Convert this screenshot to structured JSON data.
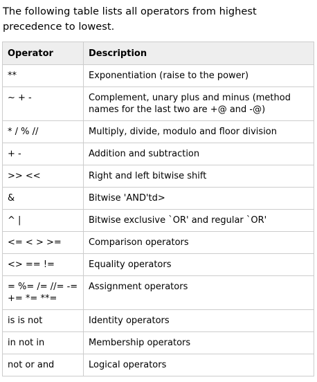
{
  "intro": "The following table lists all operators from highest precedence to lowest.",
  "table": {
    "headers": [
      "Operator",
      "Description"
    ],
    "rows": [
      {
        "operator": "**",
        "description": "Exponentiation (raise to the power)"
      },
      {
        "operator": "~ + -",
        "description": "Complement, unary plus and minus (method names for the last two are +@ and -@)"
      },
      {
        "operator": "* / % //",
        "description": "Multiply, divide, modulo and floor division"
      },
      {
        "operator": "+ -",
        "description": "Addition and subtraction"
      },
      {
        "operator": ">> <<",
        "description": "Right and left bitwise shift"
      },
      {
        "operator": "&",
        "description": "Bitwise 'AND'td>"
      },
      {
        "operator": "^ |",
        "description": "Bitwise exclusive `OR' and regular `OR'"
      },
      {
        "operator": "<= < > >=",
        "description": "Comparison operators"
      },
      {
        "operator": "<> == !=",
        "description": "Equality operators"
      },
      {
        "operator": "= %= /= //= -= += *= **=",
        "description": "Assignment operators"
      },
      {
        "operator": "is is not",
        "description": "Identity operators"
      },
      {
        "operator": "in not in",
        "description": "Membership operators"
      },
      {
        "operator": "not or and",
        "description": "Logical operators"
      }
    ]
  }
}
